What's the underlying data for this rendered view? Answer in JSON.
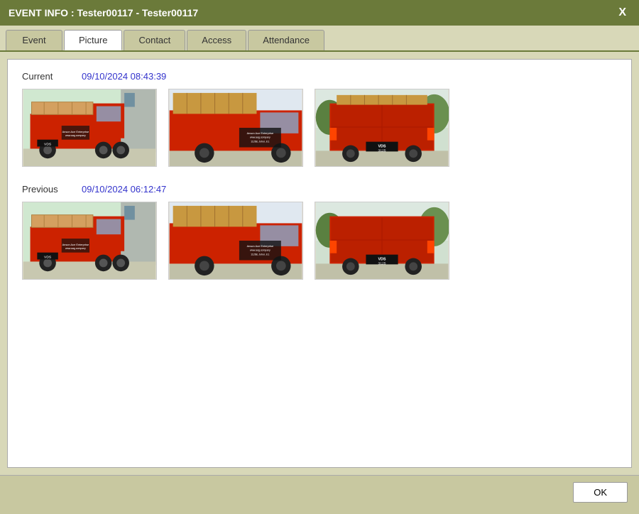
{
  "titlebar": {
    "title": "EVENT INFO : Tester00117 - Tester00117",
    "close_label": "X"
  },
  "tabs": [
    {
      "id": "event",
      "label": "Event",
      "active": false
    },
    {
      "id": "picture",
      "label": "Picture",
      "active": true
    },
    {
      "id": "contact",
      "label": "Contact",
      "active": false
    },
    {
      "id": "access",
      "label": "Access",
      "active": false
    },
    {
      "id": "attendance",
      "label": "Attendance",
      "active": false
    }
  ],
  "sections": [
    {
      "id": "current",
      "label": "Current",
      "timestamp": "09/10/2024 08:43:39"
    },
    {
      "id": "previous",
      "label": "Previous",
      "timestamp": "09/10/2024 06:12:47"
    }
  ],
  "footer": {
    "ok_label": "OK"
  }
}
